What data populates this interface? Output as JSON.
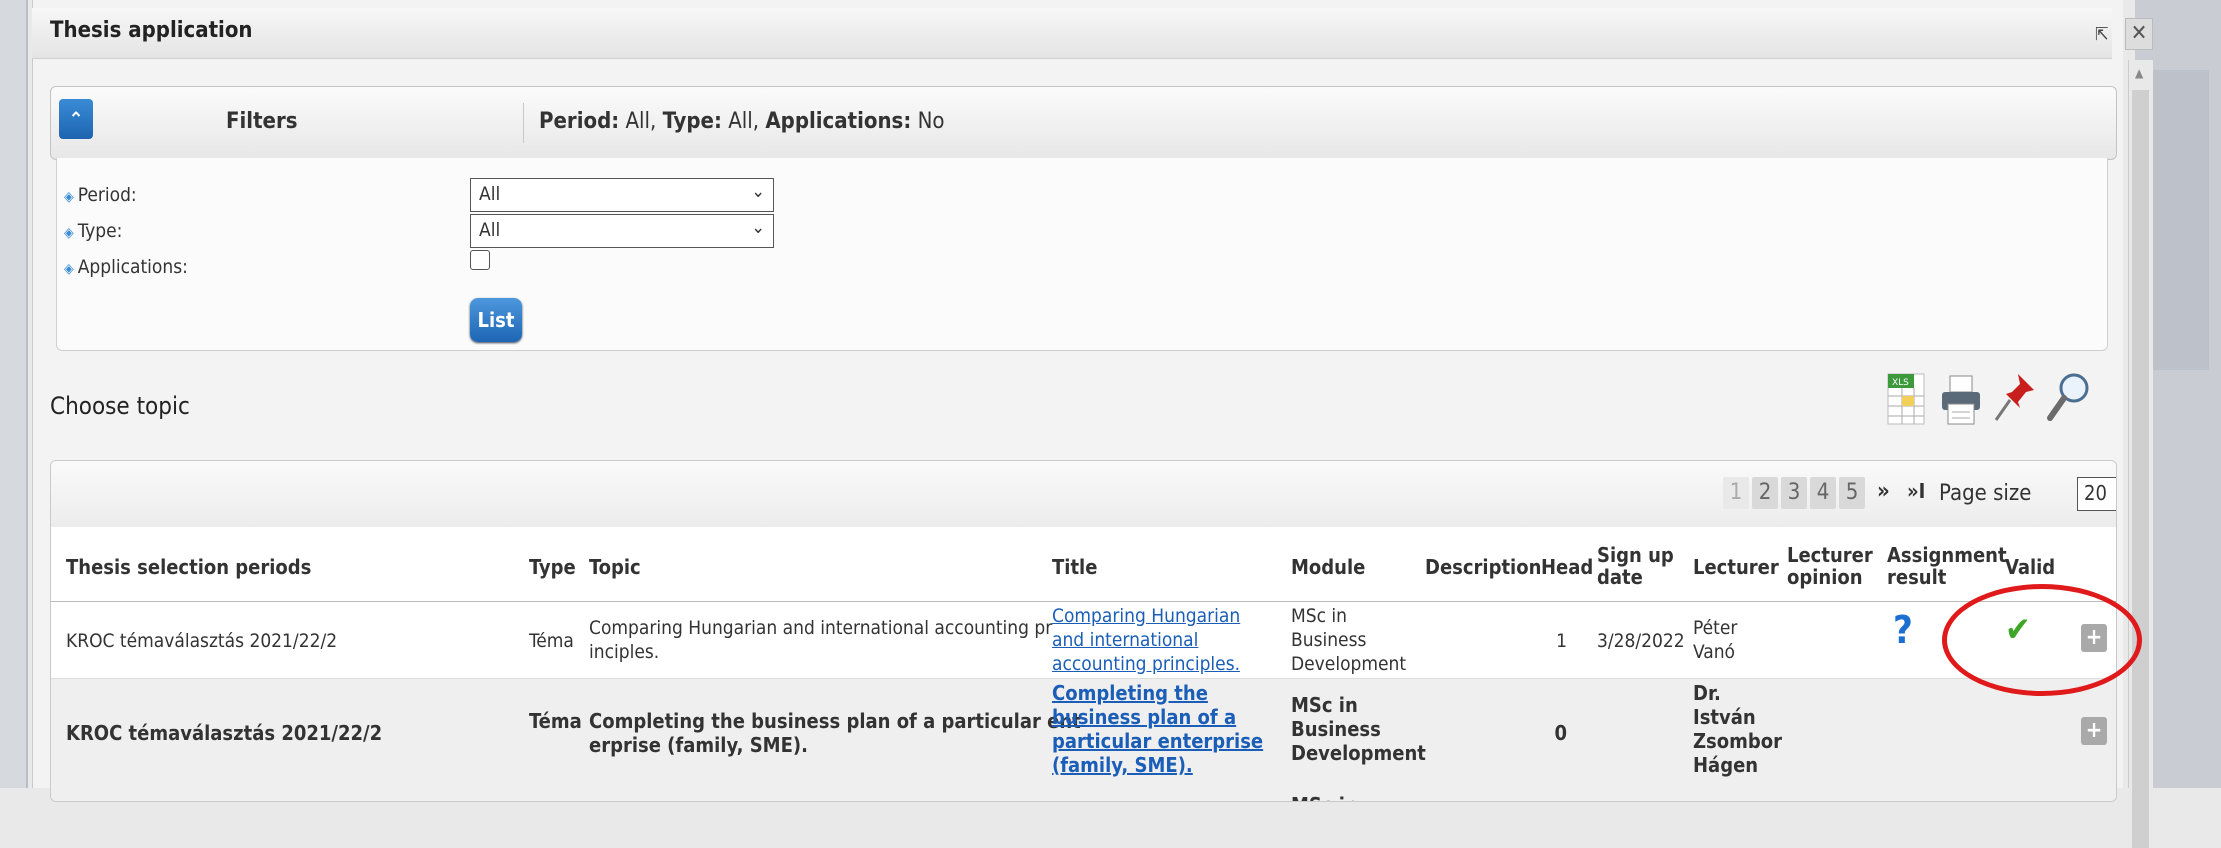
{
  "window": {
    "title": "Thesis application",
    "popout_icon": "popout-icon",
    "close_icon": "close-icon"
  },
  "filters": {
    "toggle_icon": "collapse-chevron-icon",
    "label": "Filters",
    "summary": {
      "period_key": "Period:",
      "period_val": "All",
      "type_key": "Type:",
      "type_val": "All",
      "apps_key": "Applications:",
      "apps_val": "No"
    },
    "fields": [
      {
        "label": "Period:",
        "value": "All"
      },
      {
        "label": "Type:",
        "value": "All"
      },
      {
        "label": "Applications:",
        "checked": false
      }
    ],
    "list_button": "List"
  },
  "section_title": "Choose topic",
  "toolbar": {
    "icons": [
      "excel-export-icon",
      "print-icon",
      "pin-icon",
      "search-icon"
    ],
    "xls_badge": "XLS"
  },
  "pager": {
    "pages": [
      "1",
      "2",
      "3",
      "4",
      "5"
    ],
    "current": "1",
    "next": "»",
    "last": "»I",
    "page_size_label": "Page size",
    "page_size": "20"
  },
  "table": {
    "headers": {
      "period": "Thesis selection periods",
      "type": "Type",
      "topic": "Topic",
      "title": "Title",
      "module": "Module",
      "description": "Description",
      "head": "Head",
      "signup1": "Sign up",
      "signup2": "date",
      "lecturer": "Lecturer",
      "opinion1": "Lecturer",
      "opinion2": "opinion",
      "assign1": "Assignment",
      "assign2": "result",
      "valid": "Valid"
    },
    "rows": [
      {
        "period": "KROC témaválasztás 2021/22/2",
        "type": "Téma",
        "topic1": "Comparing Hungarian and international accounting pr",
        "topic2": "inciples.",
        "title1": " Comparing Hungarian",
        "title2": "and international",
        "title3": "accounting principles.",
        "module1": "MSc in",
        "module2": "Business",
        "module3": "Development",
        "head": "1",
        "signup": "3/28/2022",
        "lecturer1": "Péter",
        "lecturer2": "Vanó",
        "assignment_icon": "question-icon",
        "valid_icon": "checkmark-icon",
        "expand": "+"
      },
      {
        "period": "KROC témaválasztás 2021/22/2",
        "type": "Téma",
        "topic1": "Completing the business plan of a particular ent",
        "topic2": "erprise (family, SME).",
        "title1": "Completing the",
        "title2": "business plan of a",
        "title3": "particular enterprise",
        "title4": "(family, SME).",
        "module1": "MSc in",
        "module2": "Business",
        "module3": "Development",
        "head": "0",
        "lecturer1": "Dr.",
        "lecturer2": "István",
        "lecturer3": "Zsombor",
        "lecturer4": "Hágen",
        "expand": "+"
      }
    ],
    "row3_partial": "MSc in"
  }
}
